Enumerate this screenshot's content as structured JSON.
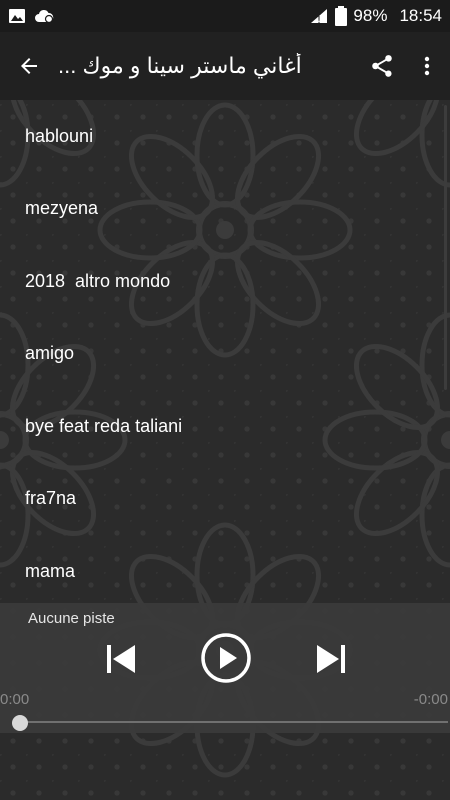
{
  "status_bar": {
    "battery": "98%",
    "time": "18:54",
    "icons": [
      "image-notification-icon",
      "cloud-notification-icon",
      "wifi-icon",
      "battery-icon"
    ]
  },
  "toolbar": {
    "title": "أغاني ماستر سينا و موك ...",
    "back_icon": "arrow-left-icon",
    "share_icon": "share-icon",
    "menu_icon": "more-vert-icon"
  },
  "tracks": [
    "hablouni",
    "mezyena",
    "2018  altro mondo",
    "amigo",
    "bye feat reda taliani",
    "fra7na",
    "mama"
  ],
  "player": {
    "status": "Aucune piste",
    "elapsed": "0:00",
    "remaining": "-0:00",
    "progress_fraction": 0,
    "controls": [
      "skip-previous-icon",
      "play-icon",
      "skip-next-icon"
    ]
  },
  "colors": {
    "background": "#2b2b2b",
    "toolbar": "#212121",
    "status_bar": "#1b1b1b",
    "player_panel": "#3a3a3a",
    "text": "#ffffff",
    "muted_text": "#8a8a8a"
  }
}
